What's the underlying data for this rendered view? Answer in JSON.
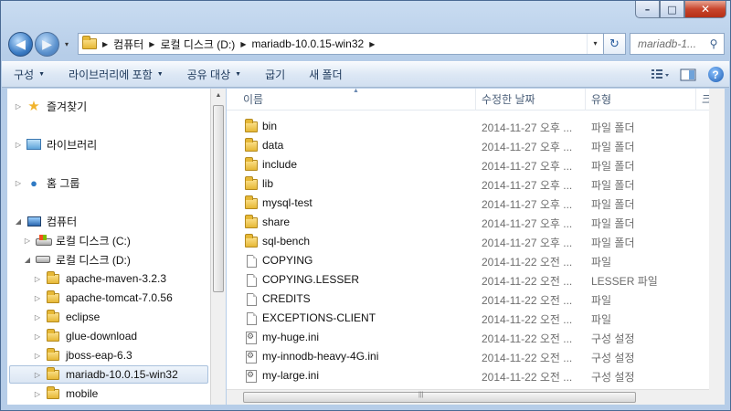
{
  "window": {
    "controls": {
      "minimize": "–",
      "maximize": "□",
      "close": "✕"
    }
  },
  "nav": {
    "back_icon": "back-arrow-icon",
    "forward_icon": "forward-arrow-icon",
    "history_caret": "▾"
  },
  "address": {
    "crumbs": [
      "컴퓨터",
      "로컬 디스크 (D:)",
      "mariadb-10.0.15-win32"
    ],
    "dropdown": "▾",
    "refresh": "↻"
  },
  "search": {
    "placeholder": "mariadb-1...",
    "icon": "search-icon"
  },
  "toolbar": {
    "organize": "구성",
    "include_in_library": "라이브러리에 포함",
    "share_with": "공유 대상",
    "burn": "굽기",
    "new_folder": "새 폴더",
    "caret": "▼"
  },
  "navpane": {
    "favorites": "즐겨찾기",
    "libraries": "라이브러리",
    "homegroup": "홈 그룹",
    "computer": "컴퓨터",
    "drive_c": "로컬 디스크 (C:)",
    "drive_d": "로컬 디스크 (D:)",
    "folders": [
      "apache-maven-3.2.3",
      "apache-tomcat-7.0.56",
      "eclipse",
      "glue-download",
      "jboss-eap-6.3",
      "mariadb-10.0.15-win32",
      "mobile"
    ],
    "selected_folder": "mariadb-10.0.15-win32"
  },
  "columns": {
    "name": "이름",
    "modified": "수정한 날짜",
    "type": "유형",
    "more": "크"
  },
  "files": [
    {
      "name": "bin",
      "date": "2014-11-27 오후 ...",
      "type": "파일 폴더",
      "kind": "folder"
    },
    {
      "name": "data",
      "date": "2014-11-27 오후 ...",
      "type": "파일 폴더",
      "kind": "folder"
    },
    {
      "name": "include",
      "date": "2014-11-27 오후 ...",
      "type": "파일 폴더",
      "kind": "folder"
    },
    {
      "name": "lib",
      "date": "2014-11-27 오후 ...",
      "type": "파일 폴더",
      "kind": "folder"
    },
    {
      "name": "mysql-test",
      "date": "2014-11-27 오후 ...",
      "type": "파일 폴더",
      "kind": "folder"
    },
    {
      "name": "share",
      "date": "2014-11-27 오후 ...",
      "type": "파일 폴더",
      "kind": "folder"
    },
    {
      "name": "sql-bench",
      "date": "2014-11-27 오후 ...",
      "type": "파일 폴더",
      "kind": "folder"
    },
    {
      "name": "COPYING",
      "date": "2014-11-22 오전 ...",
      "type": "파일",
      "kind": "doc"
    },
    {
      "name": "COPYING.LESSER",
      "date": "2014-11-22 오전 ...",
      "type": "LESSER 파일",
      "kind": "doc"
    },
    {
      "name": "CREDITS",
      "date": "2014-11-22 오전 ...",
      "type": "파일",
      "kind": "doc"
    },
    {
      "name": "EXCEPTIONS-CLIENT",
      "date": "2014-11-22 오전 ...",
      "type": "파일",
      "kind": "doc"
    },
    {
      "name": "my-huge.ini",
      "date": "2014-11-22 오전 ...",
      "type": "구성 설정",
      "kind": "ini"
    },
    {
      "name": "my-innodb-heavy-4G.ini",
      "date": "2014-11-22 오전 ...",
      "type": "구성 설정",
      "kind": "ini"
    },
    {
      "name": "my-large.ini",
      "date": "2014-11-22 오전 ...",
      "type": "구성 설정",
      "kind": "ini"
    }
  ]
}
